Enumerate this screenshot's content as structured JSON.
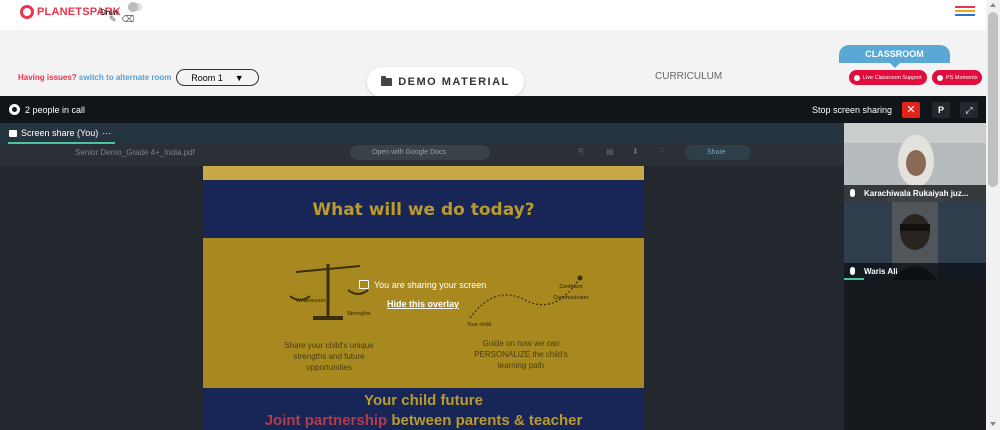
{
  "header": {
    "logo_text": "PLANETSPARK",
    "draw_label": "Draw",
    "pencil_glyph": "✎",
    "eraser_glyph": "⌫",
    "menu_colors": [
      "#e8344e",
      "#f2a31b",
      "#2f6fd1"
    ]
  },
  "toolbar": {
    "issues_text": "Having issues?",
    "alternate_room_link": "switch to alternate room",
    "room_select_value": "Room 1",
    "room_select_arrow": "▼",
    "demo_material_label": "DEMO MATERIAL",
    "curriculum_label": "CURRICULUM",
    "classroom_tab_label": "CLASSROOM",
    "live_support_label": "Live Classroom Support",
    "ps_moments_label": "PS Moments"
  },
  "call": {
    "people_count_text": "2 people in call",
    "stop_sharing_label": "Stop screen sharing",
    "close_glyph": "✕",
    "p_button_label": "P",
    "expand_glyph": "⤢",
    "share_tab_label": "Screen share (You)",
    "share_tab_menu": "···"
  },
  "shared_screen": {
    "pdf_filename": "Senior Demo_Grade 4+_India.pdf",
    "open_with_label": "Open with Google Docs",
    "share_label": "Share",
    "slide_title": "What will we do today?",
    "weaknesses_label": "Weaknesses",
    "strengths_label": "Strengths",
    "left_caption": "Share your child's unique strengths and future opportunities",
    "your_child_label": "Your child",
    "confident_label": "Confident Communicator",
    "right_caption": "Guide on how we can PERSONALIZE the child's learning path",
    "overlay_title": "You are sharing your screen",
    "overlay_link": "Hide this overlay",
    "subtitle_line1": "Your child future",
    "subtitle_red": "Joint partnership",
    "subtitle_rest": " between parents & teacher"
  },
  "participants": [
    {
      "name": "Karachiwala Rukaiyah juz..."
    },
    {
      "name": "Waris Ali"
    }
  ],
  "colors": {
    "brand_red": "#e8344e",
    "accent_blue": "#5aa8d6",
    "pill_red": "#e00d3d",
    "stop_red": "#e2231a",
    "call_bg": "#15191d"
  }
}
